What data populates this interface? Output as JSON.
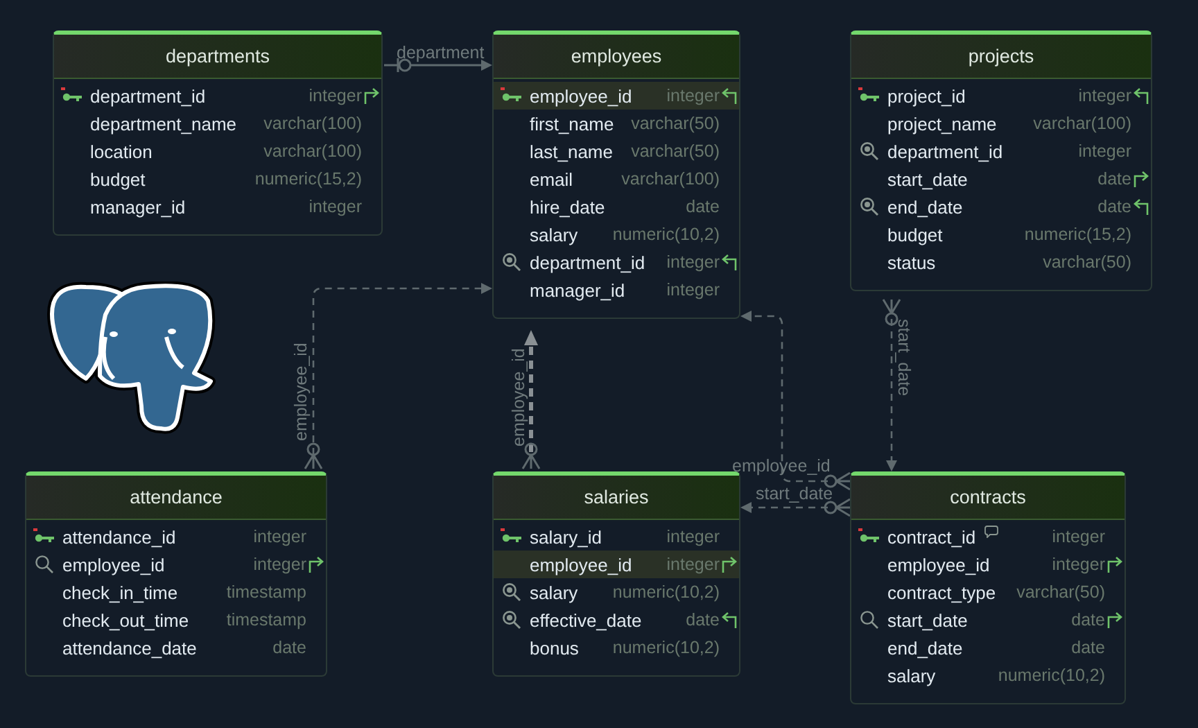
{
  "tables": [
    {
      "name": "departments",
      "columns": [
        {
          "name": "department_id",
          "type": "integer",
          "kind": "primary_key",
          "outgoing_link": true,
          "incoming_link": false,
          "commented": false,
          "highlighted": false
        },
        {
          "name": "department_name",
          "type": "varchar(100)",
          "kind": "plain",
          "outgoing_link": false,
          "incoming_link": false,
          "commented": false,
          "highlighted": false
        },
        {
          "name": "location",
          "type": "varchar(100)",
          "kind": "plain",
          "outgoing_link": false,
          "incoming_link": false,
          "commented": false,
          "highlighted": false
        },
        {
          "name": "budget",
          "type": "numeric(15,2)",
          "kind": "plain",
          "outgoing_link": false,
          "incoming_link": false,
          "commented": false,
          "highlighted": false
        },
        {
          "name": "manager_id",
          "type": "integer",
          "kind": "plain",
          "outgoing_link": false,
          "incoming_link": false,
          "commented": false,
          "highlighted": false
        }
      ]
    },
    {
      "name": "employees",
      "columns": [
        {
          "name": "employee_id",
          "type": "integer",
          "kind": "primary_key",
          "outgoing_link": false,
          "incoming_link": true,
          "commented": false,
          "highlighted": true
        },
        {
          "name": "first_name",
          "type": "varchar(50)",
          "kind": "plain",
          "outgoing_link": false,
          "incoming_link": false,
          "commented": false,
          "highlighted": false
        },
        {
          "name": "last_name",
          "type": "varchar(50)",
          "kind": "plain",
          "outgoing_link": false,
          "incoming_link": false,
          "commented": false,
          "highlighted": false
        },
        {
          "name": "email",
          "type": "varchar(100)",
          "kind": "plain",
          "outgoing_link": false,
          "incoming_link": false,
          "commented": false,
          "highlighted": false
        },
        {
          "name": "hire_date",
          "type": "date",
          "kind": "plain",
          "outgoing_link": false,
          "incoming_link": false,
          "commented": false,
          "highlighted": false
        },
        {
          "name": "salary",
          "type": "numeric(10,2)",
          "kind": "plain",
          "outgoing_link": false,
          "incoming_link": false,
          "commented": false,
          "highlighted": false
        },
        {
          "name": "department_id",
          "type": "integer",
          "kind": "indexed",
          "outgoing_link": false,
          "incoming_link": true,
          "commented": false,
          "highlighted": false
        },
        {
          "name": "manager_id",
          "type": "integer",
          "kind": "plain",
          "outgoing_link": false,
          "incoming_link": false,
          "commented": false,
          "highlighted": false
        }
      ]
    },
    {
      "name": "projects",
      "columns": [
        {
          "name": "project_id",
          "type": "integer",
          "kind": "primary_key",
          "outgoing_link": false,
          "incoming_link": true,
          "commented": false,
          "highlighted": false
        },
        {
          "name": "project_name",
          "type": "varchar(100)",
          "kind": "plain",
          "outgoing_link": false,
          "incoming_link": false,
          "commented": false,
          "highlighted": false
        },
        {
          "name": "department_id",
          "type": "integer",
          "kind": "indexed",
          "outgoing_link": false,
          "incoming_link": false,
          "commented": false,
          "highlighted": false
        },
        {
          "name": "start_date",
          "type": "date",
          "kind": "plain",
          "outgoing_link": true,
          "incoming_link": false,
          "commented": false,
          "highlighted": false
        },
        {
          "name": "end_date",
          "type": "date",
          "kind": "indexed",
          "outgoing_link": false,
          "incoming_link": true,
          "commented": false,
          "highlighted": false
        },
        {
          "name": "budget",
          "type": "numeric(15,2)",
          "kind": "plain",
          "outgoing_link": false,
          "incoming_link": false,
          "commented": false,
          "highlighted": false
        },
        {
          "name": "status",
          "type": "varchar(50)",
          "kind": "plain",
          "outgoing_link": false,
          "incoming_link": false,
          "commented": false,
          "highlighted": false
        }
      ]
    },
    {
      "name": "attendance",
      "columns": [
        {
          "name": "attendance_id",
          "type": "integer",
          "kind": "primary_key",
          "outgoing_link": false,
          "incoming_link": false,
          "commented": false,
          "highlighted": false
        },
        {
          "name": "employee_id",
          "type": "integer",
          "kind": "searchable",
          "outgoing_link": true,
          "incoming_link": false,
          "commented": false,
          "highlighted": false
        },
        {
          "name": "check_in_time",
          "type": "timestamp",
          "kind": "plain",
          "outgoing_link": false,
          "incoming_link": false,
          "commented": false,
          "highlighted": false
        },
        {
          "name": "check_out_time",
          "type": "timestamp",
          "kind": "plain",
          "outgoing_link": false,
          "incoming_link": false,
          "commented": false,
          "highlighted": false
        },
        {
          "name": "attendance_date",
          "type": "date",
          "kind": "plain",
          "outgoing_link": false,
          "incoming_link": false,
          "commented": false,
          "highlighted": false
        }
      ]
    },
    {
      "name": "salaries",
      "columns": [
        {
          "name": "salary_id",
          "type": "integer",
          "kind": "primary_key",
          "outgoing_link": false,
          "incoming_link": false,
          "commented": false,
          "highlighted": false
        },
        {
          "name": "employee_id",
          "type": "integer",
          "kind": "plain",
          "outgoing_link": true,
          "incoming_link": false,
          "commented": false,
          "highlighted": true
        },
        {
          "name": "salary",
          "type": "numeric(10,2)",
          "kind": "indexed",
          "outgoing_link": false,
          "incoming_link": false,
          "commented": false,
          "highlighted": false
        },
        {
          "name": "effective_date",
          "type": "date",
          "kind": "indexed",
          "outgoing_link": false,
          "incoming_link": true,
          "commented": false,
          "highlighted": false
        },
        {
          "name": "bonus",
          "type": "numeric(10,2)",
          "kind": "plain",
          "outgoing_link": false,
          "incoming_link": false,
          "commented": false,
          "highlighted": false
        }
      ]
    },
    {
      "name": "contracts",
      "columns": [
        {
          "name": "contract_id",
          "type": "integer",
          "kind": "primary_key",
          "outgoing_link": false,
          "incoming_link": false,
          "commented": true,
          "highlighted": false
        },
        {
          "name": "employee_id",
          "type": "integer",
          "kind": "plain",
          "outgoing_link": true,
          "incoming_link": false,
          "commented": false,
          "highlighted": false
        },
        {
          "name": "contract_type",
          "type": "varchar(50)",
          "kind": "plain",
          "outgoing_link": false,
          "incoming_link": false,
          "commented": false,
          "highlighted": false
        },
        {
          "name": "start_date",
          "type": "date",
          "kind": "searchable",
          "outgoing_link": true,
          "incoming_link": false,
          "commented": false,
          "highlighted": false
        },
        {
          "name": "end_date",
          "type": "date",
          "kind": "plain",
          "outgoing_link": false,
          "incoming_link": false,
          "commented": false,
          "highlighted": false
        },
        {
          "name": "salary",
          "type": "numeric(10,2)",
          "kind": "plain",
          "outgoing_link": false,
          "incoming_link": false,
          "commented": false,
          "highlighted": false
        }
      ]
    }
  ],
  "relationships": [
    {
      "label": "department"
    },
    {
      "label": "employee_id"
    },
    {
      "label": "employee_id"
    },
    {
      "label": "start_date"
    },
    {
      "label": "employee_id"
    },
    {
      "label": "start_date"
    }
  ]
}
